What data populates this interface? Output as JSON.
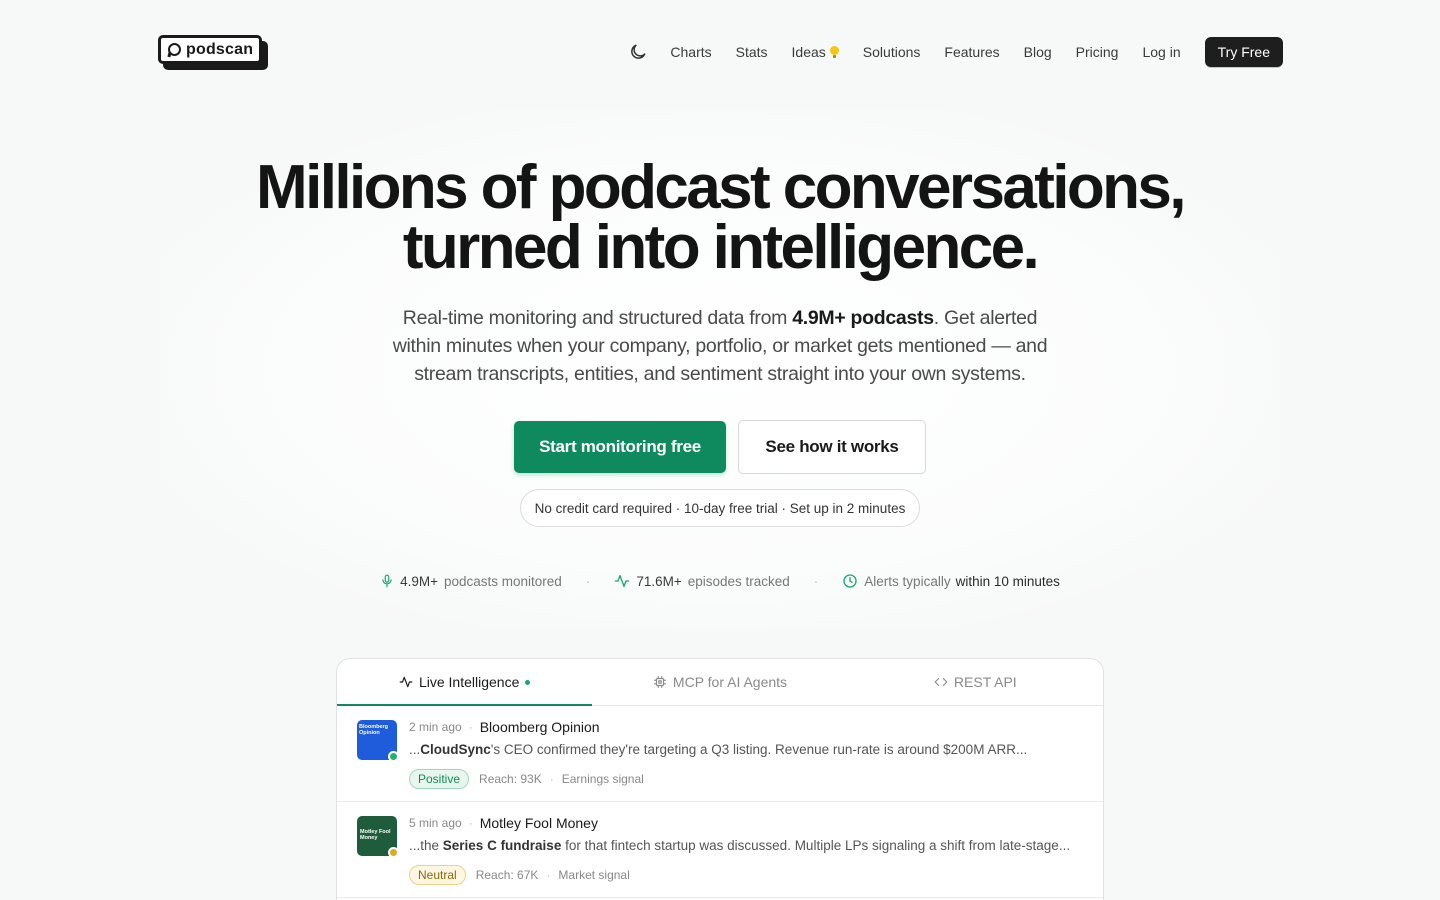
{
  "brand": {
    "name": "podscan"
  },
  "nav": {
    "items": [
      "Charts",
      "Stats",
      "Ideas",
      "Solutions",
      "Features",
      "Blog",
      "Pricing",
      "Log in"
    ],
    "cta": "Try Free"
  },
  "hero": {
    "title_line1": "Millions of podcast conversations,",
    "title_line2": "turned into intelligence.",
    "sub_pre": "Real-time monitoring and structured data from ",
    "sub_bold": "4.9M+ podcasts",
    "sub_post": ". Get alerted within minutes when your company, portfolio, or market gets mentioned — and stream transcripts, entities, and sentiment straight into your own systems.",
    "primary_cta": "Start monitoring free",
    "secondary_cta": "See how it works",
    "note": "No credit card required · 10-day free trial · Set up in 2 minutes"
  },
  "stats": [
    {
      "num": "4.9M+",
      "label": "podcasts monitored",
      "icon": "mic-icon"
    },
    {
      "num": "71.6M+",
      "label": "episodes tracked",
      "icon": "activity-icon"
    },
    {
      "label": "Alerts typically",
      "highlight": "within 10 minutes",
      "icon": "clock-icon"
    }
  ],
  "stat_sep": "·",
  "tabs": [
    {
      "label": "Live Intelligence",
      "icon": "activity-icon",
      "active": true
    },
    {
      "label": "MCP for AI Agents",
      "icon": "chip-icon"
    },
    {
      "label": "REST API",
      "icon": "code-icon"
    }
  ],
  "feed": [
    {
      "time": "2 min ago",
      "source": "Bloomberg Opinion",
      "thumb_text": "Bloomberg Opinion",
      "quote_pre": "...",
      "quote_bold": "CloudSync",
      "quote_post": "'s CEO confirmed they're targeting a Q3 listing. Revenue run-rate is around $200M ARR...",
      "sentiment": "Positive",
      "reach": "Reach: 93K",
      "signal": "Earnings signal",
      "status_color": "#1fb36e"
    },
    {
      "time": "5 min ago",
      "source": "Motley Fool Money",
      "thumb_text": "Motley Fool Money",
      "quote_pre": "...the ",
      "quote_bold": "Series C fundraise",
      "quote_post": " for that fintech startup was discussed. Multiple LPs signaling a shift from late-stage...",
      "sentiment": "Neutral",
      "reach": "Reach: 67K",
      "signal": "Market signal",
      "status_color": "#e3a821"
    }
  ],
  "feed_sep": "·",
  "colors": {
    "accent": "#0f8a5f",
    "dark": "#1e1e1e"
  }
}
